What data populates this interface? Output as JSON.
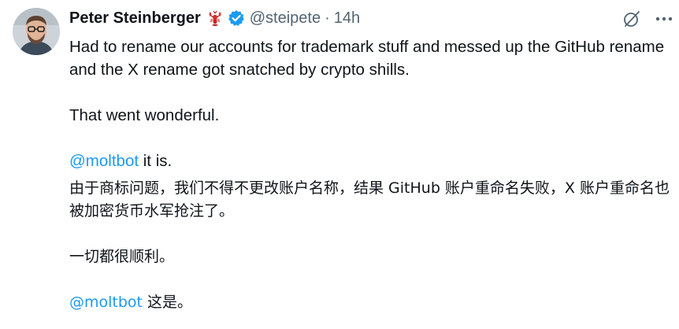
{
  "author": {
    "name": "Peter Steinberger",
    "handle": "@steipete",
    "separator": "·",
    "time": "14h",
    "emoji_icon": "lobster-icon",
    "verified_icon": "verified-badge-icon"
  },
  "actions": {
    "grok_icon": "grok-icon",
    "more_label": "···"
  },
  "tweet": {
    "en_line1": "Had to rename our accounts for trademark stuff and messed up the GitHub rename and the X rename got snatched by crypto shills.",
    "en_line2": "That went wonderful.",
    "en_mention": "@moltbot",
    "en_mention_suffix": " it is.",
    "zh_line1": "由于商标问题，我们不得不更改账户名称，结果 GitHub 账户重命名失败，X 账户重命名也被加密货币水军抢注了。",
    "zh_line2": "一切都很顺利。",
    "zh_mention": "@moltbot",
    "zh_mention_suffix": " 这是。"
  },
  "colors": {
    "text": "#0f1419",
    "secondary": "#536471",
    "link": "#1d9bf0",
    "verified": "#1d9bf0",
    "lobster": "#c62828"
  }
}
